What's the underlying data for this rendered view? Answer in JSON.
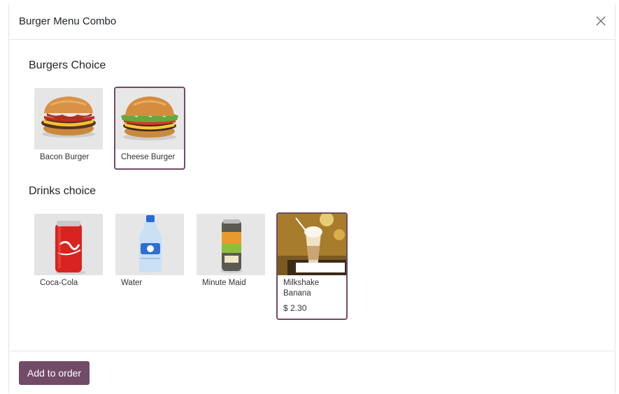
{
  "dialog": {
    "title": "Burger Menu Combo",
    "close_icon": "close-icon"
  },
  "burgers": {
    "title": "Burgers Choice",
    "items": [
      {
        "name": "Bacon Burger",
        "icon": "bacon-burger-image",
        "selected": false
      },
      {
        "name": "Cheese Burger",
        "icon": "cheese-burger-image",
        "selected": true
      }
    ]
  },
  "drinks": {
    "title": "Drinks choice",
    "items": [
      {
        "name": "Coca-Cola",
        "icon": "coca-cola-image",
        "selected": false
      },
      {
        "name": "Water",
        "icon": "water-bottle-image",
        "selected": false
      },
      {
        "name": "Minute Maid",
        "icon": "minute-maid-can-image",
        "selected": false
      },
      {
        "name": "Milkshake Banana",
        "icon": "milkshake-image",
        "selected": true,
        "price": "$ 2.30"
      }
    ]
  },
  "footer": {
    "add_label": "Add to order"
  },
  "colors": {
    "accent": "#714b67",
    "selected_border": "#714b67"
  }
}
